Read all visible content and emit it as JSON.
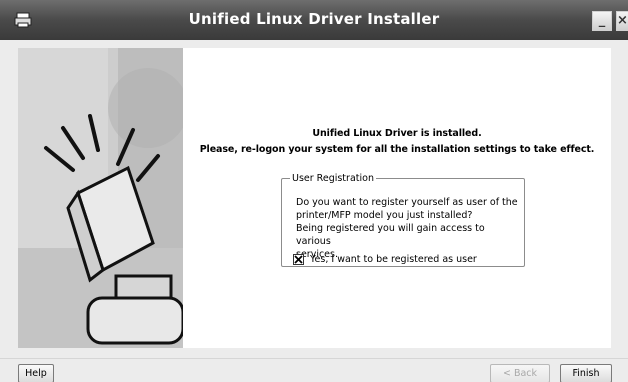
{
  "window": {
    "title": "Unified Linux Driver Installer"
  },
  "titlebar_buttons": {
    "minimize": "_",
    "close": "×"
  },
  "main": {
    "heading_line1": "Unified Linux Driver is installed.",
    "heading_line2": "Please, re-logon your system for all the installation settings to take effect."
  },
  "registration": {
    "legend": "User Registration",
    "text_line1": "Do you want to register yourself as user of the",
    "text_line2": "printer/MFP model you just installed?",
    "text_line3": "Being registered you will gain access to various",
    "text_line4": "services.",
    "checkbox_label": "Yes, I want to be registered as user",
    "checkbox_checked": true
  },
  "buttons": {
    "help": "Help",
    "back": "< Back",
    "finish": "Finish"
  },
  "colors": {
    "titlebar": "#4a4a4a",
    "dialog_bg": "#ececec",
    "content_bg": "#ffffff",
    "illustration_bg": "#c9c9c9"
  }
}
